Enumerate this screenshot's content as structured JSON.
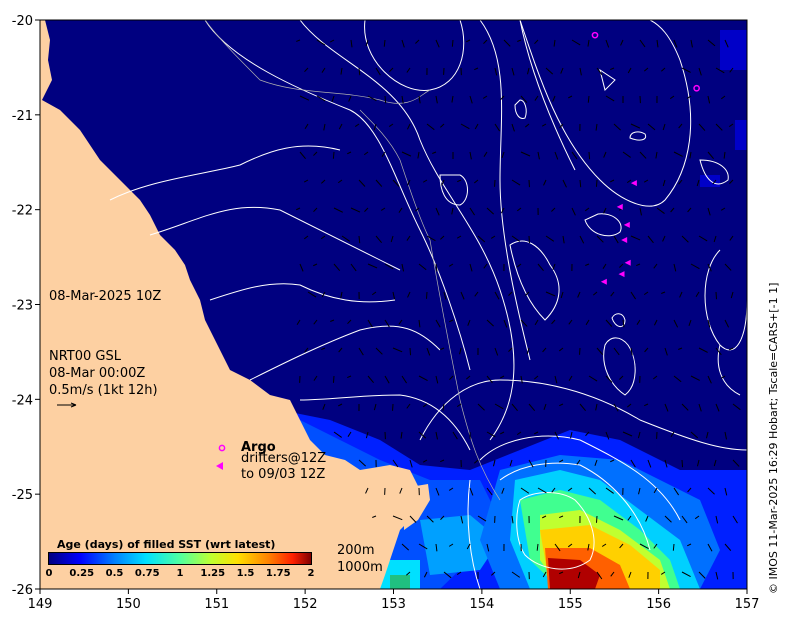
{
  "axes": {
    "x_ticks": [
      "149",
      "150",
      "151",
      "152",
      "153",
      "154",
      "155",
      "156",
      "157"
    ],
    "y_ticks": [
      "-20",
      "-21",
      "-22",
      "-23",
      "-24",
      "-25",
      "-26"
    ],
    "lon_range": [
      149,
      157
    ],
    "lat_range": [
      -26,
      -20
    ]
  },
  "labels": {
    "date": "08-Mar-2025 10Z",
    "current_product": "NRT00 GSL",
    "current_time": "08-Mar 00:00Z",
    "vector_scale": "0.5m/s (1kt 12h)",
    "argo": "Argo",
    "drifters": "drifters@12Z",
    "drifters_to": "to 09/03 12Z",
    "depth_200": "200m",
    "depth_1000": "1000m",
    "credit": "© IMOS 11-Mar-2025 16:29 Hobart; Tscale=CARS+[-1 1]"
  },
  "colorbar": {
    "title": "Age (days) of filled SST (wrt latest)",
    "ticks": [
      "0",
      "0.25",
      "0.5",
      "0.75",
      "1",
      "1.25",
      "1.5",
      "1.75",
      "2"
    ],
    "range": [
      0,
      2
    ]
  },
  "colors": {
    "ocean": "#000080",
    "land": "#fdd0a2",
    "argo_marker": "#ff00ff",
    "contour": "#ffffff"
  },
  "markers": {
    "argo": [
      {
        "lon": 155.28,
        "lat": -20.16
      },
      {
        "lon": 156.43,
        "lat": -20.72
      }
    ],
    "drifters": [
      {
        "lon": 155.72,
        "lat": -21.72
      },
      {
        "lon": 155.56,
        "lat": -21.97
      },
      {
        "lon": 155.64,
        "lat": -22.16
      },
      {
        "lon": 155.61,
        "lat": -22.32
      },
      {
        "lon": 155.65,
        "lat": -22.56
      },
      {
        "lon": 155.58,
        "lat": -22.68
      },
      {
        "lon": 155.38,
        "lat": -22.76
      }
    ]
  }
}
